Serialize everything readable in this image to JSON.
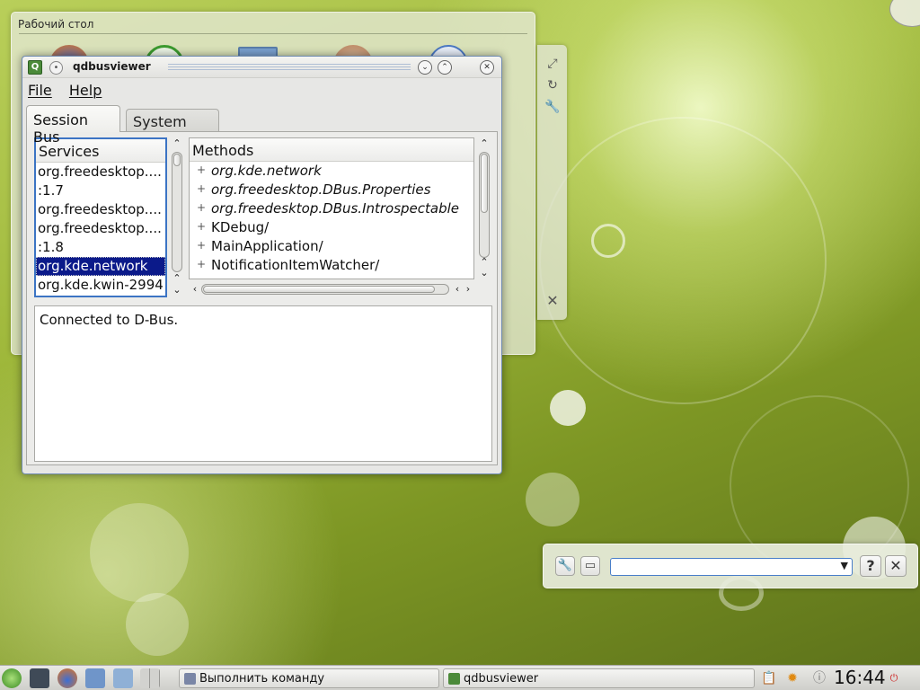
{
  "desktop": {
    "folderview_title": "Рабочий стол"
  },
  "window": {
    "title": "qdbusviewer",
    "menu": [
      {
        "label": "File"
      },
      {
        "label": "Help"
      }
    ],
    "tabs": [
      {
        "label": "Session Bus",
        "active": true
      },
      {
        "label": "System Bus",
        "active": false
      }
    ],
    "services": {
      "header": "Services",
      "items": [
        {
          "label": "org.freedesktop...."
        },
        {
          "label": ":1.7"
        },
        {
          "label": "org.freedesktop...."
        },
        {
          "label": "org.freedesktop...."
        },
        {
          "label": ":1.8"
        },
        {
          "label": "org.kde.network",
          "selected": true
        },
        {
          "label": "org.kde.kwin-2994"
        }
      ]
    },
    "methods": {
      "header": "Methods",
      "items": [
        {
          "label": "org.kde.network",
          "italic": true
        },
        {
          "label": "org.freedesktop.DBus.Properties",
          "italic": true
        },
        {
          "label": "org.freedesktop.DBus.Introspectable",
          "italic": true
        },
        {
          "label": "KDebug/",
          "italic": false
        },
        {
          "label": "MainApplication/",
          "italic": false
        },
        {
          "label": "NotificationItemWatcher/",
          "italic": false
        }
      ]
    },
    "output_text": "Connected to D-Bus."
  },
  "taskbar": {
    "tasks": [
      {
        "label": "Выполнить команду"
      },
      {
        "label": "qdbusviewer"
      }
    ],
    "clock": "16:44"
  },
  "colors": {
    "selection": "#0b1a8a",
    "focus_border": "#3c74c4"
  }
}
